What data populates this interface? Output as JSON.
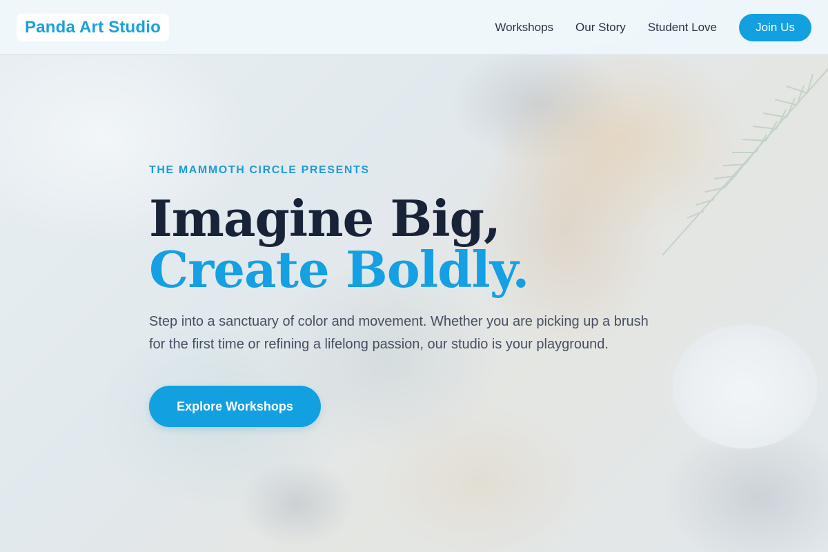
{
  "nav": {
    "brand": "Panda Art Studio",
    "links": [
      "Workshops",
      "Our Story",
      "Student Love"
    ],
    "cta": "Join Us"
  },
  "hero": {
    "eyebrow": "THE MAMMOTH CIRCLE PRESENTS",
    "headline_part1": "Imagine Big, ",
    "headline_accent": "Create Boldly.",
    "description": "Step into a sanctuary of color and movement. Whether you are picking up a brush for the first time or refining a lifelong passion, our studio is your playground.",
    "cta": "Explore Workshops"
  },
  "colors": {
    "accent": "#12a0e0",
    "heading": "#182338",
    "body_text": "#454f60"
  }
}
